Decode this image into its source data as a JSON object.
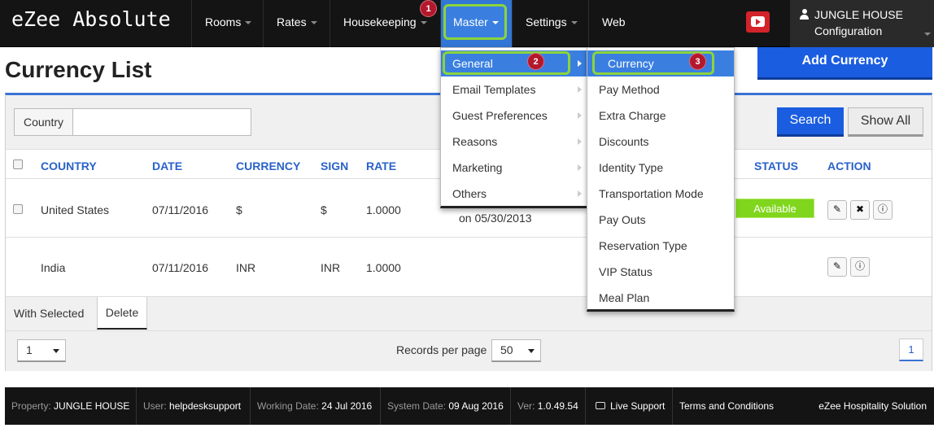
{
  "app": {
    "logo": "eZee Absolute"
  },
  "topnav": {
    "rooms": "Rooms",
    "rates": "Rates",
    "housekeeping": "Housekeeping",
    "master": "Master",
    "settings": "Settings",
    "web": "Web"
  },
  "markers": {
    "one": "1",
    "two": "2",
    "three": "3"
  },
  "user": {
    "name": "JUNGLE HOUSE",
    "subtitle": "Configuration"
  },
  "page": {
    "title": "Currency List",
    "add_button": "Add Currency"
  },
  "filter": {
    "country_label": "Country",
    "country_value": "",
    "search": "Search",
    "show_all": "Show All"
  },
  "table": {
    "columns": {
      "country": "COUNTRY",
      "date": "DATE",
      "currency": "CURRENCY",
      "sign": "SIGN",
      "rate": "RATE",
      "status": "STATUS",
      "action": "ACTION"
    },
    "rows": [
      {
        "country": "United States",
        "date": "07/11/2016",
        "currency": "$",
        "sign": "$",
        "rate": "1.0000",
        "note": "on 05/30/2013",
        "status": "Available"
      },
      {
        "country": "India",
        "date": "07/11/2016",
        "currency": "INR",
        "sign": "INR",
        "rate": "1.0000"
      }
    ]
  },
  "bulk": {
    "with_selected": "With Selected",
    "delete": "Delete"
  },
  "pager": {
    "page_select": "1",
    "records_label": "Records per page",
    "records_value": "50",
    "current_page": "1"
  },
  "menus": {
    "master": [
      "General",
      "Email Templates",
      "Guest Preferences",
      "Reasons",
      "Marketing",
      "Others"
    ],
    "general": [
      "Currency",
      "Pay Method",
      "Extra Charge",
      "Discounts",
      "Identity Type",
      "Transportation Mode",
      "Pay Outs",
      "Reservation Type",
      "VIP Status",
      "Meal Plan"
    ]
  },
  "statusbar": {
    "property_label": "Property:",
    "property": "JUNGLE HOUSE",
    "user_label": "User:",
    "user": "helpdesksupport",
    "working_label": "Working Date:",
    "working": "24 Jul 2016",
    "system_label": "System Date:",
    "system": "09 Aug 2016",
    "ver_label": "Ver:",
    "ver": "1.0.49.54",
    "live_support": "Live Support",
    "terms": "Terms and Conditions",
    "brand": "eZee Hospitality Solution"
  },
  "colors": {
    "accent": "#1a5de0",
    "highlight": "#8cd43c",
    "marker": "#b3182c",
    "available": "#80d61c",
    "header_link": "#2a62c9"
  },
  "icons": {
    "edit": "pencil-icon",
    "delete": "close-icon",
    "info": "info-icon",
    "video": "youtube-icon",
    "user": "user-icon",
    "chat": "chat-icon"
  }
}
